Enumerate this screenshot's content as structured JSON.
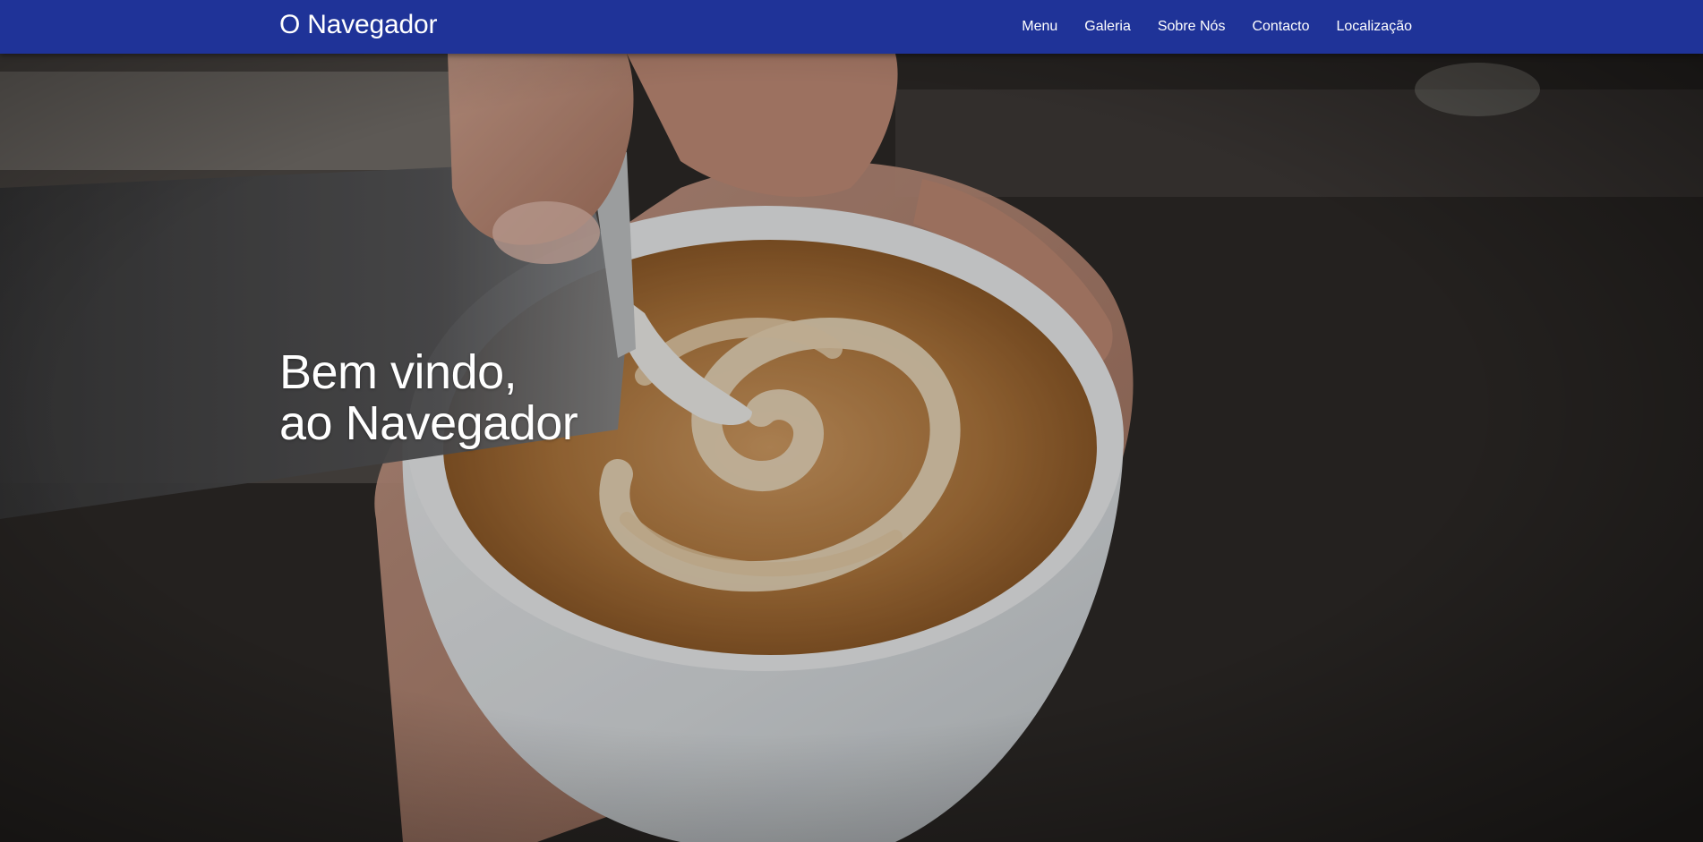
{
  "navbar": {
    "brand": "O Navegador",
    "links": [
      {
        "label": "Menu"
      },
      {
        "label": "Galeria"
      },
      {
        "label": "Sobre Nós"
      },
      {
        "label": "Contacto"
      },
      {
        "label": "Localização"
      }
    ],
    "background_color": "#1f3398"
  },
  "hero": {
    "heading_line_1": "Bem vindo,",
    "heading_line_2": "ao Navegador",
    "image_subject": "latte-art-coffee-photo"
  }
}
